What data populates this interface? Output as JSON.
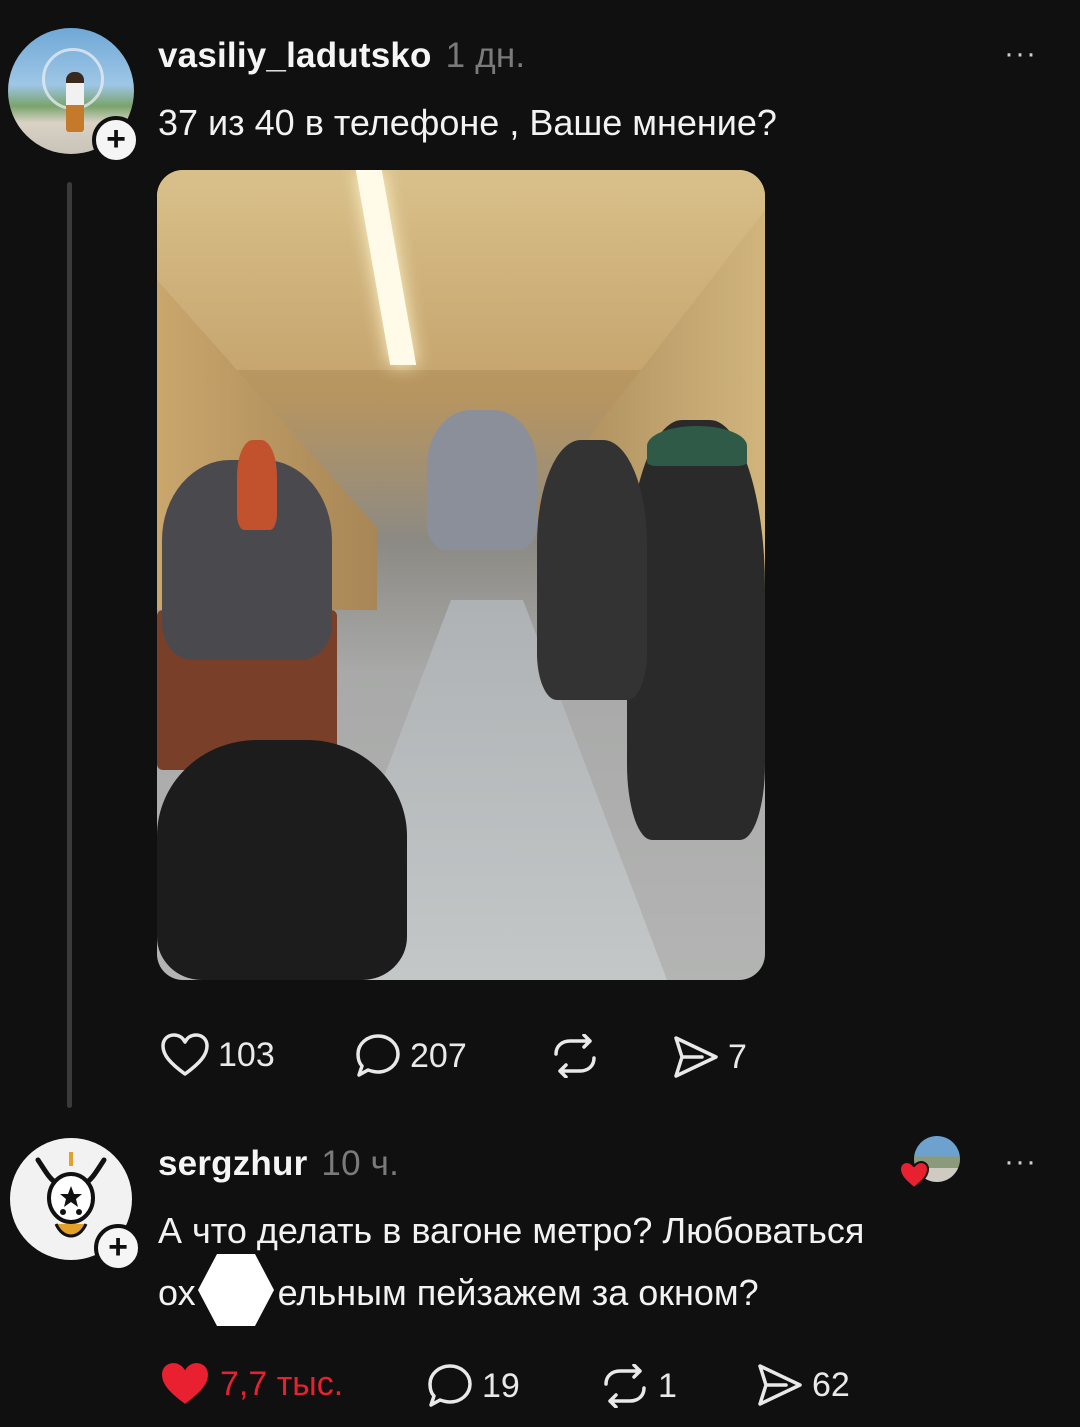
{
  "post": {
    "username": "vasiliy_ladutsko",
    "time": "1 дн.",
    "text": "37 из 40 в телефоне , Ваше мнение?",
    "stats": {
      "likes": "103",
      "comments": "207",
      "reposts": "",
      "shares": "7"
    }
  },
  "reply": {
    "username": "sergzhur",
    "time": "10 ч.",
    "text_line1": "А что делать в вагоне метро? Любоваться",
    "text_line2_prefix": "ох",
    "text_line2_suffix": "ельным пейзажем за окном?",
    "stats": {
      "likes": "7,7 тыс.",
      "comments": "19",
      "reposts": "1",
      "shares": "62"
    }
  },
  "ui": {
    "more_glyph": "···",
    "plus_glyph": "+"
  },
  "colors": {
    "background": "#101010",
    "text": "#f3f3f3",
    "muted": "#7a7a7a",
    "like_active": "#e8202f"
  },
  "icons": [
    "heart-icon",
    "comment-icon",
    "repost-icon",
    "share-icon",
    "more-icon",
    "follow-plus-icon"
  ]
}
